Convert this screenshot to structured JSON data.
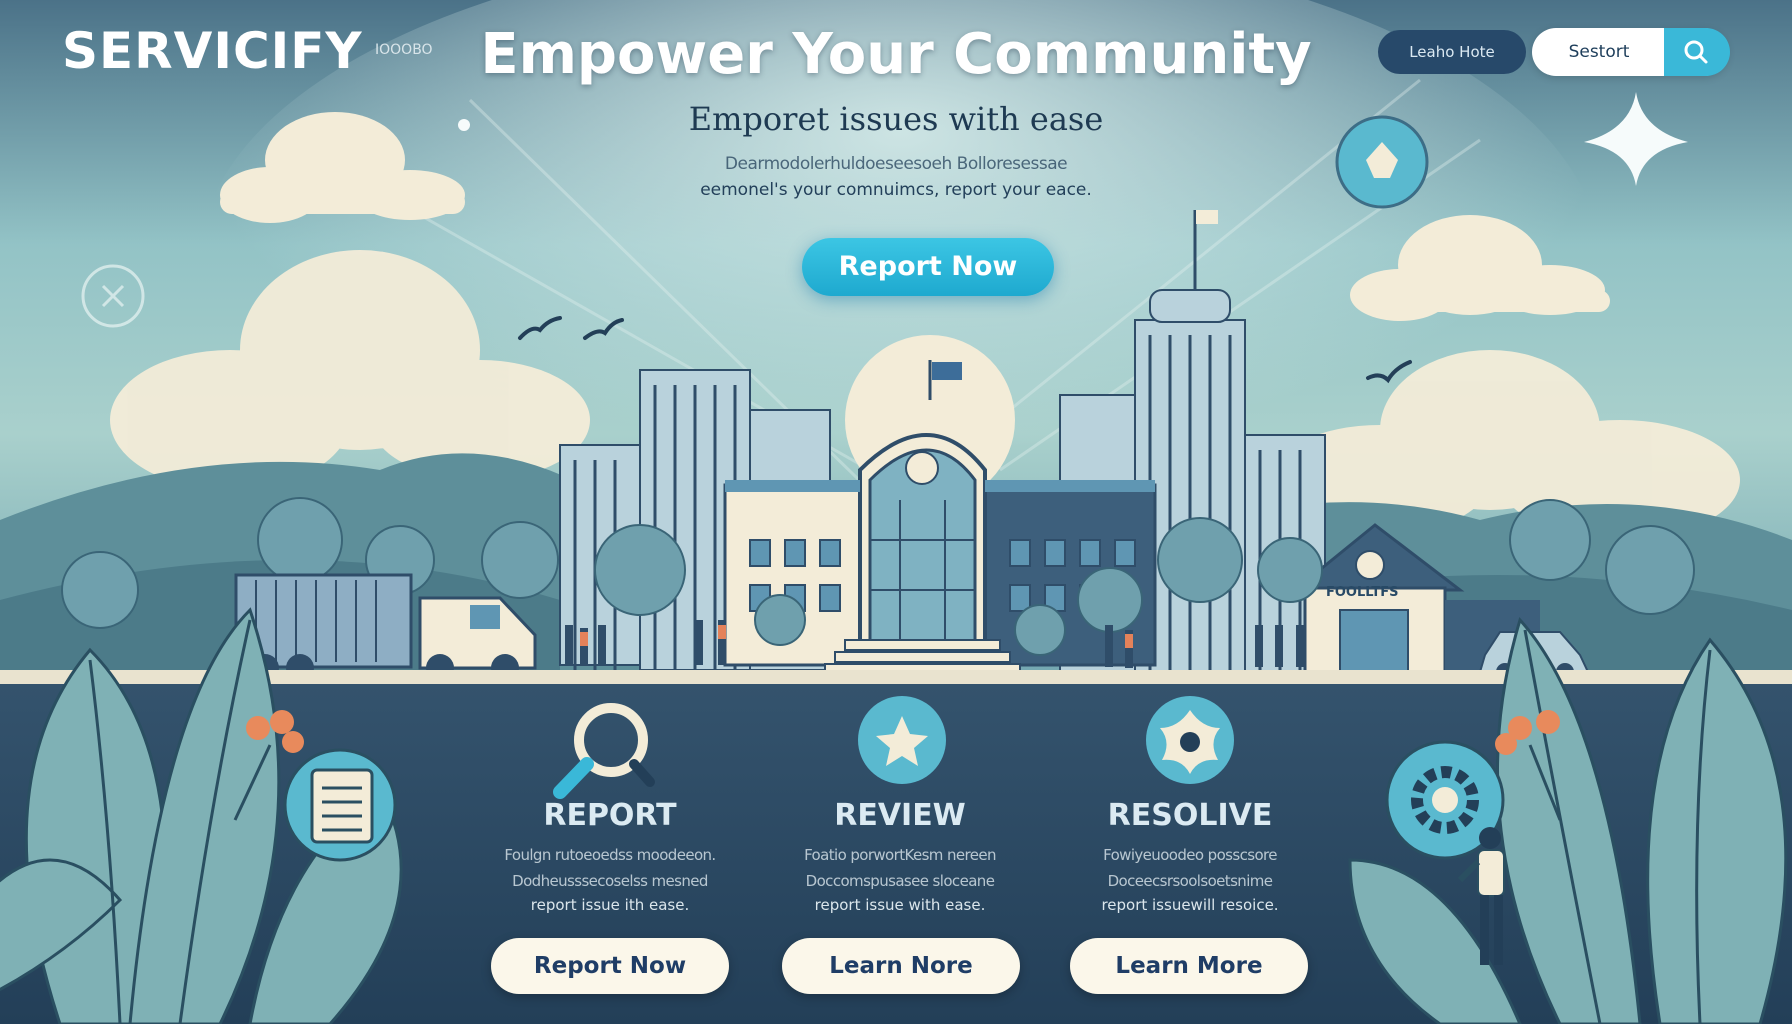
{
  "brand": {
    "name": "SERVICIFY",
    "tagline": "IOOOBO"
  },
  "header": {
    "nav_link": "Leaho Hote",
    "search": {
      "label": "Sestort",
      "icon": "search-icon"
    }
  },
  "hero": {
    "title": "Empower Your Community",
    "subtitle": "Emporet   issues with ease",
    "description_line1": "Dearmodolerhuldoeseesoeh Bolloresessae",
    "description_line2": "eemonel's your comnuimcs, report your eace.",
    "cta_label": "Report Now"
  },
  "scene": {
    "building_sign": "FOOLLTFS",
    "icons": [
      "flower-badge-icon",
      "compass-icon",
      "star-sparkle-icon",
      "bird-icon",
      "truck-icon",
      "car-icon",
      "gear-icon",
      "checklist-icon"
    ]
  },
  "steps": [
    {
      "title": "REPORT",
      "icon": "magnifier-icon",
      "desc1": "Foulgn rutoeoedss moodeeon.",
      "desc2": "Dodheusssecoselss mesned",
      "desc3": "report issue ith ease.",
      "button": "Report Now"
    },
    {
      "title": "REVIEW",
      "icon": "star-badge-icon",
      "desc1": "Foatio porwortKesm nereen",
      "desc2": "Doccomspusasee sloceane",
      "desc3": "report issue with ease.",
      "button": "Learn Nore"
    },
    {
      "title": "RESOLIVE",
      "icon": "flower-badge-icon",
      "desc1": "Fowiyeuoodeo posscsore",
      "desc2": "Doceecsrsoolsoetsnime",
      "desc3": "report issuewill resoice.",
      "button": "Learn More"
    }
  ],
  "colors": {
    "accent": "#1ea9cf",
    "button_bg": "#fbf7ea",
    "button_text": "#1f3d66",
    "sky": "#8fc0c8",
    "ground": "#2d4a63"
  }
}
